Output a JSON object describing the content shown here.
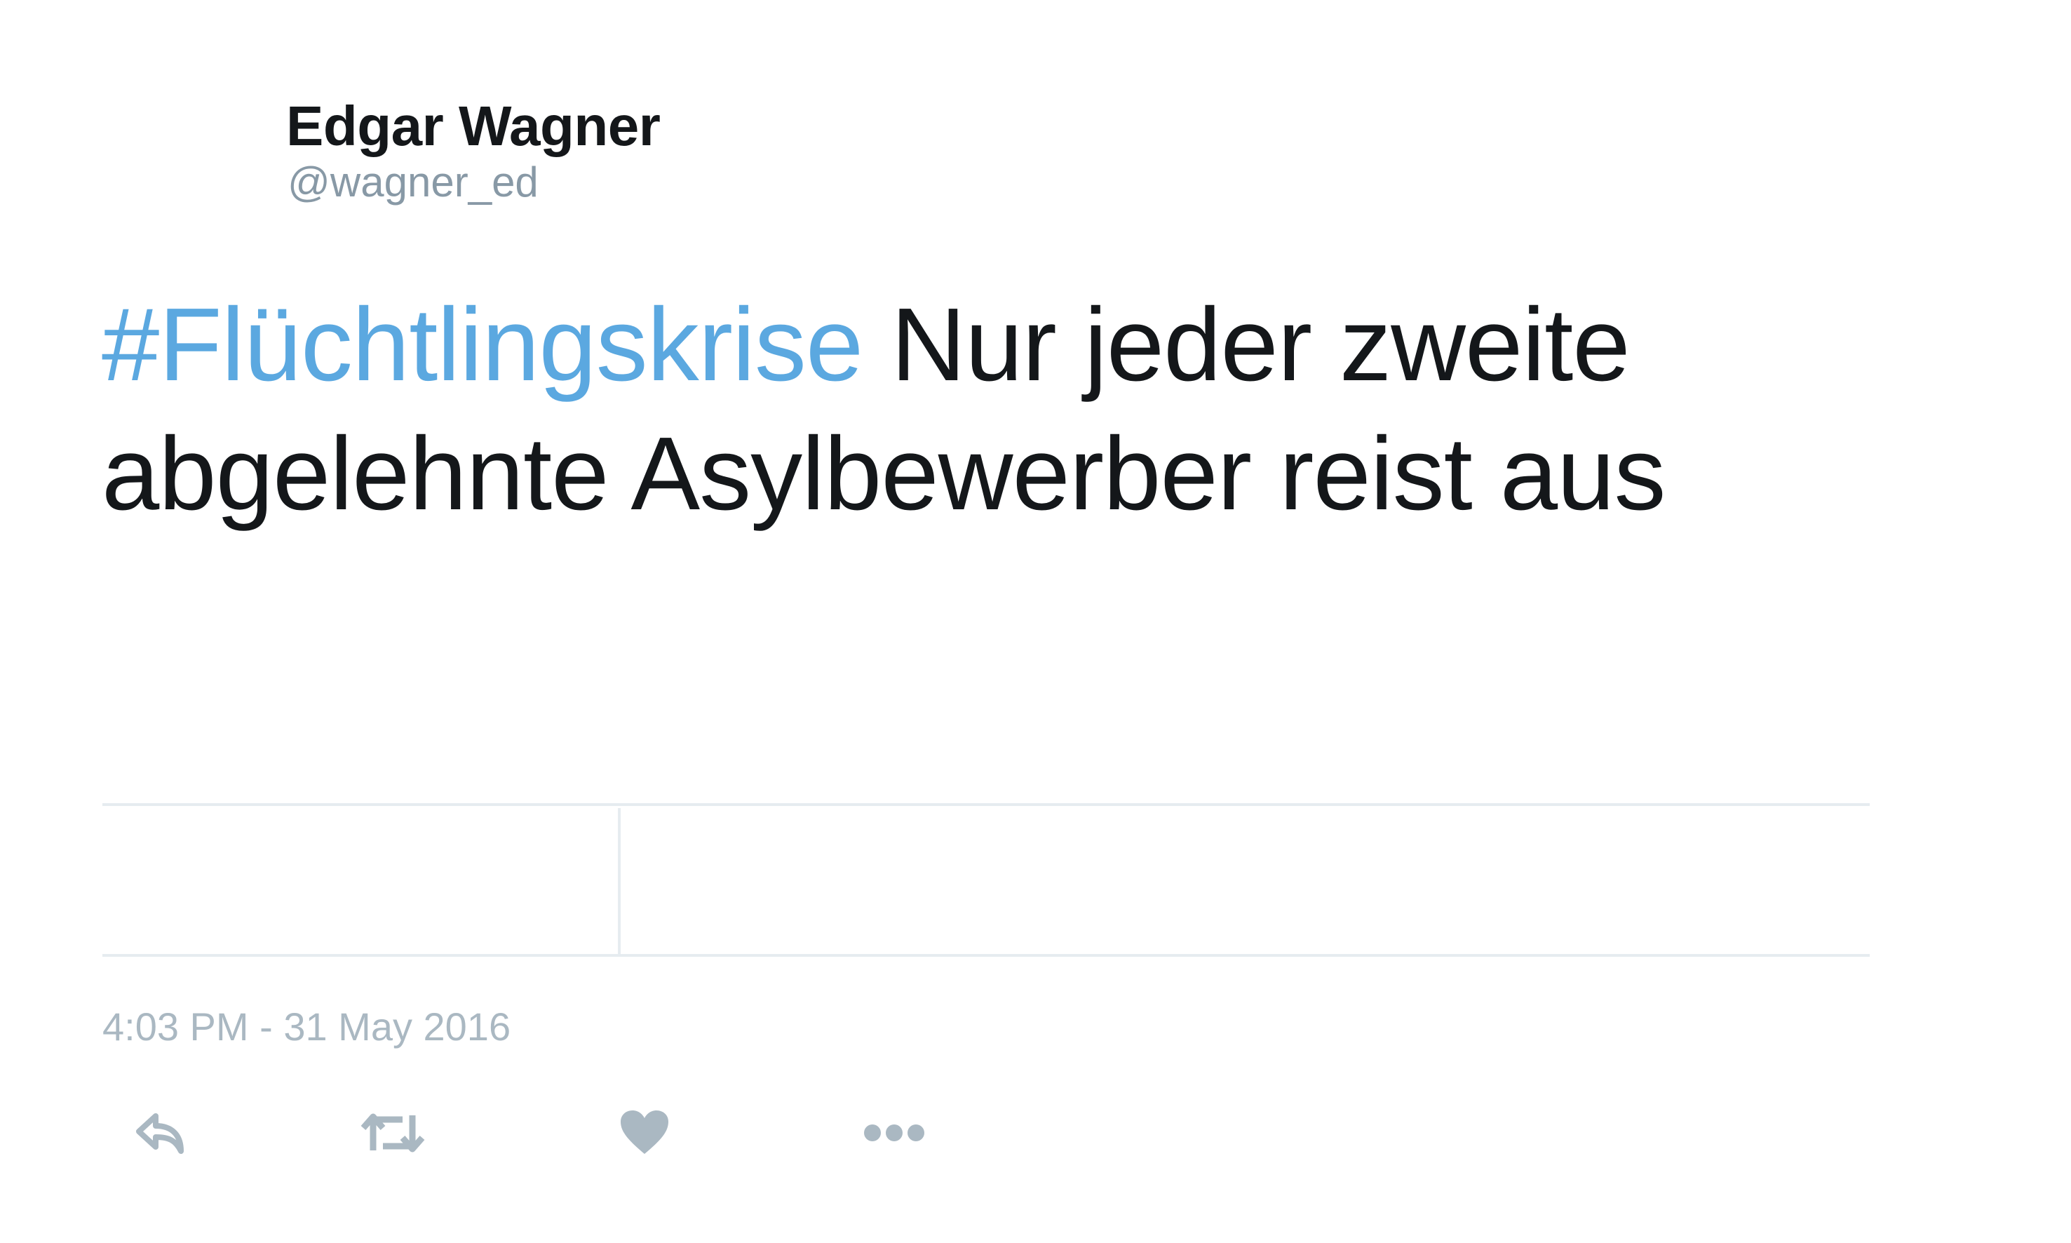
{
  "tweet": {
    "display_name": "Edgar Wagner",
    "username": "@wagner_ed",
    "hashtag": "#Flüchtlingskrise",
    "text": " Nur jeder zweite abgelehnte Asylbewerber reist aus",
    "timestamp": "4:03 PM - 31 May 2016"
  },
  "actions": {
    "reply_icon": "reply-icon",
    "retweet_icon": "retweet-icon",
    "like_icon": "heart-icon",
    "more_icon": "more-icon"
  },
  "colors": {
    "hashtag": "#5ba8e0",
    "text": "#14171a",
    "secondary": "#8899a6",
    "icon": "#aab8c2",
    "divider": "#e6ecf0"
  }
}
